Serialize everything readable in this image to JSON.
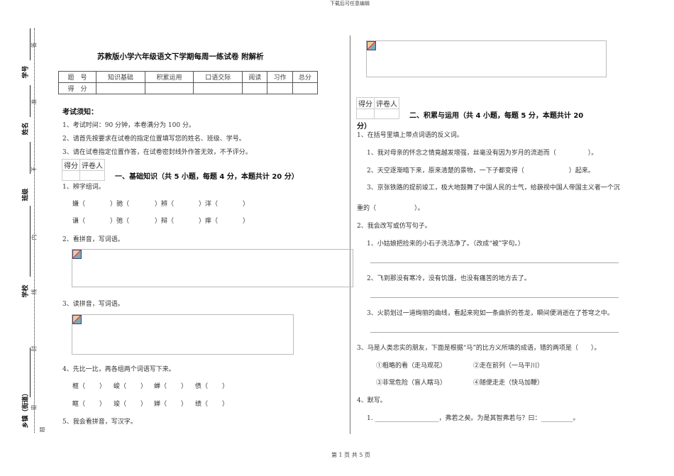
{
  "header_note": "下载后可任意编辑",
  "footer": "第 1 页 共 5 页",
  "binding_margin": {
    "labels": [
      "学号",
      "姓名",
      "班级",
      "学校",
      "乡镇（街道）"
    ],
    "seal_chars": [
      "答",
      "准",
      "不",
      "内",
      "线",
      "封",
      "密",
      "题"
    ]
  },
  "title": "苏教版小学六年级语文下学期每周一练试卷 附解析",
  "score_table": {
    "header": [
      "题　号",
      "知识基础",
      "积累运用",
      "口语交际",
      "阅读",
      "习作",
      "总分"
    ],
    "row_label": "得　分"
  },
  "instructions": {
    "heading": "考试须知：",
    "items": [
      "1、考试时间：90 分钟，本卷满分为 100 分。",
      "2、请首先按要求在试卷的指定位置填写您的姓名、班级、学号。",
      "3、请在试卷指定位置作答，在试卷密封线外作答无效，不予评分。"
    ]
  },
  "grader": {
    "score": "得分",
    "grader": "评卷人"
  },
  "section1": {
    "title": "一、基础知识（共 5 小题，每题 4 分，本题共计 20 分）",
    "q1": {
      "prompt": "1、辨字组词。",
      "row1": [
        "嫌（",
        "）驰（",
        "）辨（",
        "）洋（",
        "）"
      ],
      "row2": [
        "谦（",
        "）弛（",
        "）辩（",
        "）痒（",
        "）"
      ]
    },
    "q2": {
      "prompt": "2、看拼音，写词语。"
    },
    "q3": {
      "prompt": "3、读拼音，写词语。"
    },
    "q4": {
      "prompt": "4、先比一比，再各组两个词语写下来。",
      "row1": [
        "框（",
        "）",
        "峻（",
        "）",
        "蝉（",
        "）",
        "债（",
        "）"
      ],
      "row2": [
        "眶（",
        "）",
        "竣（",
        "）",
        "婵（",
        "）",
        "绩（",
        "）"
      ]
    },
    "q5": {
      "prompt": "5、我会看拼音，写汉字。"
    }
  },
  "section2": {
    "title_line1": "二、积累与运用（共 4 小题，每题 5 分，本题共计 20",
    "title_line2": "分）",
    "q1": {
      "prompt": "1、在括号里填上带点词语的反义词。",
      "items": [
        "1、我对母亲的怀念之情竟越发增强，丝毫没有因为岁月的流逝而（　　　　　）。",
        "2、天空逐渐暗下来，原来清楚的景物，一下子都变得（　　　　　　　）起来。",
        "3、京张铁路的提前竣工，极大地鼓舞了中国人民的士气，给藐视中国人帝国主义者一个沉"
      ],
      "continuation": "重的（　　　　　　）。"
    },
    "q2": {
      "prompt": "2、我会改写或仿写句子。",
      "items": [
        "1、小姑娘把捡来的小石子洗洁净了。（改成“被”字句。）",
        "2、飞到那没有寒冷，没有饥饿，也没有痛苦的地方去了。",
        "3、火箭划过一道绚丽的曲线，看起来宛如一条曲折的苍龙，瞬间便消逝在了苍穹之中。"
      ]
    },
    "q3": {
      "prompt": "3、马是人类忠实的朋友，下面是根据“马”的比方义所填的成语，错的两项是（　　）。",
      "options": [
        "①粗略的看（走马观花）",
        "②走在前列（一马平川）",
        "③非常危险（盲人瞎马）",
        "④随便走走（快马加鞭）"
      ]
    },
    "q4": {
      "prompt": "4、默写。",
      "item": "1. ____________________，弗若之矣。为是其智弗若与？曰：__________。"
    }
  }
}
